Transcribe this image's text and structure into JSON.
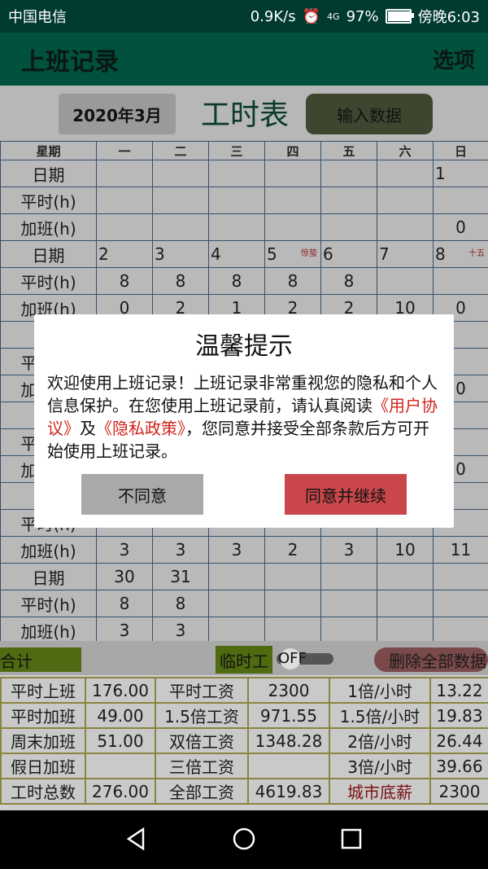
{
  "status": {
    "carrier": "中国电信",
    "speed": "0.9K/s",
    "network": "4G",
    "battery": "97%",
    "battery_level": 0.97,
    "time": "傍晚6:03"
  },
  "app": {
    "title": "上班记录",
    "options": "选项"
  },
  "toolbar": {
    "month": "2020年3月",
    "sheet_title": "工时表",
    "input_data": "输入数据"
  },
  "calendar": {
    "headers": [
      "星期",
      "一",
      "二",
      "三",
      "四",
      "五",
      "六",
      "日"
    ],
    "rows": [
      {
        "label": "日期",
        "type": "date",
        "cells": [
          "",
          "",
          "",
          "",
          "",
          "",
          "1"
        ]
      },
      {
        "label": "平时(h)",
        "type": "num",
        "cells": [
          "",
          "",
          "",
          "",
          "",
          "",
          ""
        ]
      },
      {
        "label": "加班(h)",
        "type": "num",
        "cells": [
          "",
          "",
          "",
          "",
          "",
          "",
          "0"
        ]
      },
      {
        "label": "日期",
        "type": "date",
        "cells": [
          "2",
          "3",
          "4",
          "5",
          "6",
          "7",
          "8"
        ],
        "tags": [
          "",
          "",
          "",
          "惊蛰",
          "",
          "",
          "十五"
        ]
      },
      {
        "label": "平时(h)",
        "type": "num",
        "cells": [
          "8",
          "8",
          "8",
          "8",
          "8",
          "",
          ""
        ]
      },
      {
        "label": "加班(h)",
        "type": "num",
        "cells": [
          "0",
          "2",
          "1",
          "2",
          "2",
          "10",
          "0"
        ]
      },
      {
        "label": "日期",
        "type": "date",
        "cells": [
          "",
          "",
          "",
          "",
          "",
          "",
          ""
        ]
      },
      {
        "label": "平时(h)",
        "type": "num",
        "cells": [
          "",
          "",
          "",
          "",
          "",
          "",
          ""
        ]
      },
      {
        "label": "加班(h)",
        "type": "num",
        "cells": [
          "",
          "",
          "",
          "",
          "",
          "",
          "0"
        ]
      },
      {
        "label": "日期",
        "type": "date",
        "cells": [
          "",
          "",
          "",
          "",
          "",
          "",
          ""
        ]
      },
      {
        "label": "平时(h)",
        "type": "num",
        "cells": [
          "",
          "",
          "",
          "",
          "",
          "",
          ""
        ]
      },
      {
        "label": "加班(h)",
        "type": "num",
        "cells": [
          "",
          "",
          "",
          "",
          "",
          "",
          "0"
        ]
      },
      {
        "label": "日期",
        "type": "date",
        "cells": [
          "",
          "",
          "",
          "",
          "",
          "",
          ""
        ]
      },
      {
        "label": "平时(h)",
        "type": "num",
        "cells": [
          "",
          "",
          "",
          "",
          "",
          "",
          ""
        ]
      },
      {
        "label": "加班(h)",
        "type": "num",
        "cells": [
          "3",
          "3",
          "3",
          "2",
          "3",
          "10",
          "11"
        ]
      },
      {
        "label": "日期",
        "type": "num",
        "cells": [
          "30",
          "31",
          "",
          "",
          "",
          "",
          ""
        ]
      },
      {
        "label": "平时(h)",
        "type": "num",
        "cells": [
          "8",
          "8",
          "",
          "",
          "",
          "",
          ""
        ]
      },
      {
        "label": "加班(h)",
        "type": "num",
        "cells": [
          "3",
          "3",
          "",
          "",
          "",
          "",
          ""
        ]
      }
    ]
  },
  "totals_bar": {
    "total": "合计",
    "temp_work": "临时工",
    "switch_label": "OFF",
    "delete_all": "删除全部数据"
  },
  "summary": {
    "rows": [
      [
        "平时上班",
        "176.00",
        "平时工资",
        "2300",
        "1倍/小时",
        "13.22"
      ],
      [
        "平时加班",
        "49.00",
        "1.5倍工资",
        "971.55",
        "1.5倍/小时",
        "19.83"
      ],
      [
        "周末加班",
        "51.00",
        "双倍工资",
        "1348.28",
        "2倍/小时",
        "26.44"
      ],
      [
        "假日加班",
        "",
        "三倍工资",
        "",
        "3倍/小时",
        "39.66"
      ],
      [
        "工时总数",
        "276.00",
        "全部工资",
        "4619.83",
        "城市底薪",
        "2300"
      ]
    ]
  },
  "dialog": {
    "title": "温馨提示",
    "body_1": "欢迎使用上班记录！上班记录非常重视您的隐私和个人信息保护。在您使用上班记录前，请认真阅读",
    "link_1": "《用户协议》",
    "body_2": "及",
    "link_2": "《隐私政策》",
    "body_3": "，您同意并接受全部条款后方可开始使用上班记录。",
    "disagree": "不同意",
    "agree": "同意并继续"
  }
}
